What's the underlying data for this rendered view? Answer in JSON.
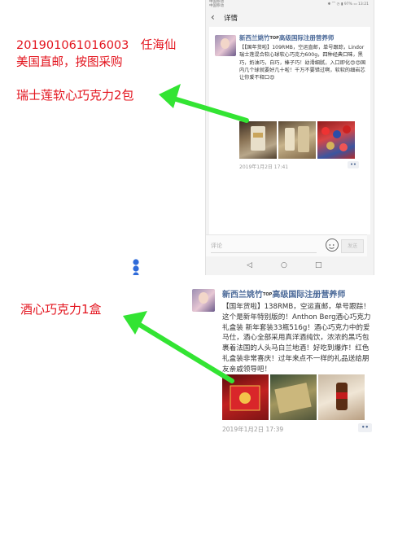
{
  "annotations": {
    "order_line1": "201901061016003　任海仙",
    "order_line2": "美国直邮，按图采购",
    "item1": "瑞士莲软心巧克力2包",
    "item2": "酒心巧克力1盒"
  },
  "phone": {
    "carrier_line1": "中国移动",
    "carrier_line2": "中国移动",
    "status_right": "✱ ⌒ ◷ ▮ 97% ▭ 13:21",
    "nav_title": "详情",
    "comment_placeholder": "评论",
    "send_label": "发送",
    "sysnav": {
      "back": "◁",
      "home": "○",
      "recent": "□"
    }
  },
  "post1": {
    "name": "新西兰姚竹",
    "badge": "TOP",
    "title_suffix": "高级国际注册营养师",
    "text": "【【国年货啦】109RMB，空运直邮，单号跟踪，Lindor瑞士莲混合软心球软心巧克力600g，四种经典口味，黑巧，奶油巧，白巧，榛子巧！幼滑细腻，入口即化😍😍国内几个球就要好几十啦！千万不要错过啊，软软的细岩芯让你爱不释口😍",
    "time": "2019年1月2日 17:41",
    "more": "••"
  },
  "post2": {
    "name": "新西兰姚竹",
    "badge": "TOP",
    "title_suffix": "高级国际注册营养师",
    "text": "【国年货啦】138RMB，空运直邮，单号跟踪！这个是新年特别版的！Anthon Berg酒心巧克力礼盒装 新年套装33瓶516g！酒心巧克力中的爱马仕，酒心全部采用真洋酒纯饮，浓浓的黑巧包裹着法国的人头马白兰地酒！好吃到爆炸！红色礼盒装非常喜庆！过年来点不一样的礼品送给朋友亲戚领导吧！",
    "time": "2019年1月2日 17:39",
    "more": "••"
  },
  "colors": {
    "annotation_red": "#e3141e",
    "arrow_green": "#33e433",
    "wechat_blue": "#4c6a99",
    "scroll_handle": "#2f6bd9"
  }
}
